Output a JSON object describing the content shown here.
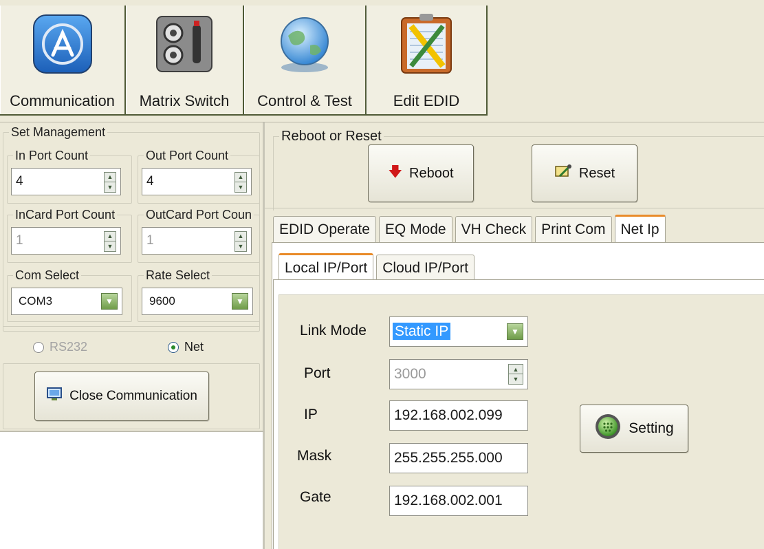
{
  "toolbar": {
    "buttons": [
      {
        "label": "Communication",
        "icon": "app-store-icon"
      },
      {
        "label": "Matrix Switch",
        "icon": "switch-panel-icon"
      },
      {
        "label": "Control & Test",
        "icon": "globe-icon"
      },
      {
        "label": "Edit EDID",
        "icon": "clipboard-pencil-icon"
      }
    ]
  },
  "left": {
    "set_management": "Set Management",
    "in_port_count": {
      "label": "In Port Count",
      "value": "4"
    },
    "out_port_count": {
      "label": "Out Port Count",
      "value": "4"
    },
    "incard_port_count": {
      "label": "InCard Port Count",
      "value": "1"
    },
    "outcard_port_count": {
      "label": "OutCard Port Coun",
      "value": "1"
    },
    "com_select": {
      "label": "Com Select",
      "value": "COM3"
    },
    "rate_select": {
      "label": "Rate Select",
      "value": "9600"
    },
    "radio_rs232": "RS232",
    "radio_net": "Net",
    "close_comm": "Close Communication"
  },
  "right": {
    "reboot_reset_title": "Reboot or Reset",
    "reboot_label": "Reboot",
    "reset_label": "Reset",
    "tabs": [
      "EDID Operate",
      "EQ Mode",
      "VH Check",
      "Print Com",
      "Net Ip"
    ],
    "subtabs": [
      "Local IP/Port",
      "Cloud IP/Port"
    ],
    "form": {
      "link_mode_label": "Link Mode",
      "link_mode_value": "Static IP",
      "port_label": "Port",
      "port_value": "3000",
      "ip_label": "IP",
      "ip_value": "192.168.002.099",
      "mask_label": "Mask",
      "mask_value": "255.255.255.000",
      "gate_label": "Gate",
      "gate_value": "192.168.002.001",
      "setting_label": "Setting"
    }
  },
  "colors": {
    "window_bg": "#ece9d8",
    "active_tab_accent": "#e98b2a",
    "selection": "#3399ff"
  }
}
